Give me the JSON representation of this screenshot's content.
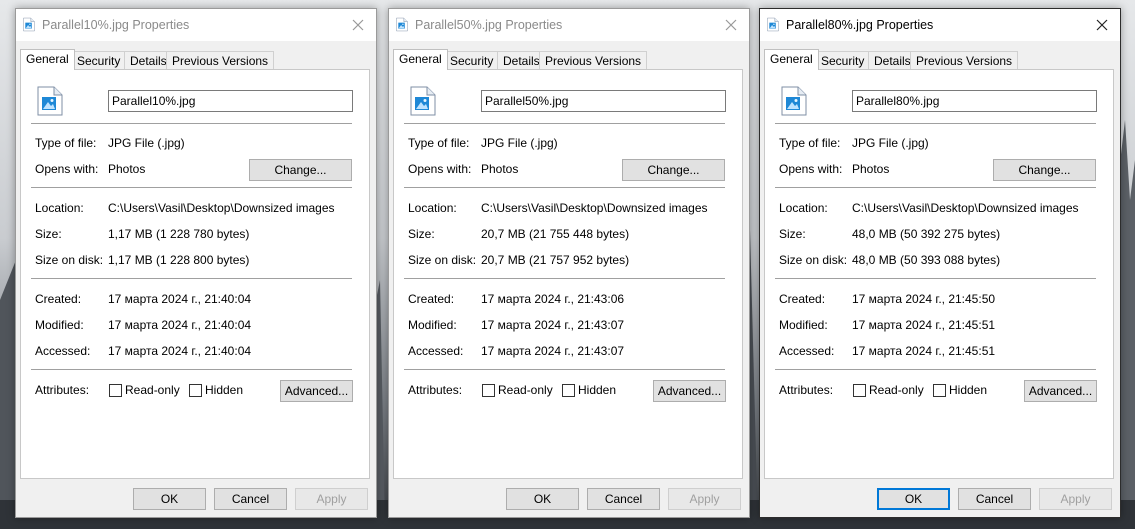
{
  "tabs": {
    "general": "General",
    "security": "Security",
    "details": "Details",
    "previous_versions": "Previous Versions"
  },
  "labels": {
    "type_of_file": "Type of file:",
    "opens_with": "Opens with:",
    "location": "Location:",
    "size": "Size:",
    "size_on_disk": "Size on disk:",
    "created": "Created:",
    "modified": "Modified:",
    "accessed": "Accessed:",
    "attributes": "Attributes:",
    "read_only": "Read-only",
    "hidden": "Hidden"
  },
  "buttons": {
    "change": "Change...",
    "advanced": "Advanced...",
    "ok": "OK",
    "cancel": "Cancel",
    "apply": "Apply"
  },
  "dialogs": [
    {
      "title": "Parallel10%.jpg Properties",
      "filename": "Parallel10%.jpg",
      "type_of_file": "JPG File (.jpg)",
      "opens_with": "Photos",
      "location": "C:\\Users\\Vasil\\Desktop\\Downsized images",
      "size": "1,17 MB (1 228 780 bytes)",
      "size_on_disk": "1,17 MB (1 228 800 bytes)",
      "created": "17 марта 2024 г., 21:40:04",
      "modified": "17 марта 2024 г., 21:40:04",
      "accessed": "17 марта 2024 г., 21:40:04",
      "read_only": false,
      "hidden": false,
      "active": false
    },
    {
      "title": "Parallel50%.jpg Properties",
      "filename": "Parallel50%.jpg",
      "type_of_file": "JPG File (.jpg)",
      "opens_with": "Photos",
      "location": "C:\\Users\\Vasil\\Desktop\\Downsized images",
      "size": "20,7 MB (21 755 448 bytes)",
      "size_on_disk": "20,7 MB (21 757 952 bytes)",
      "created": "17 марта 2024 г., 21:43:06",
      "modified": "17 марта 2024 г., 21:43:07",
      "accessed": "17 марта 2024 г., 21:43:07",
      "read_only": false,
      "hidden": false,
      "active": false
    },
    {
      "title": "Parallel80%.jpg Properties",
      "filename": "Parallel80%.jpg",
      "type_of_file": "JPG File (.jpg)",
      "opens_with": "Photos",
      "location": "C:\\Users\\Vasil\\Desktop\\Downsized images",
      "size": "48,0 MB (50 392 275 bytes)",
      "size_on_disk": "48,0 MB (50 393 088 bytes)",
      "created": "17 марта 2024 г., 21:45:50",
      "modified": "17 марта 2024 г., 21:45:51",
      "accessed": "17 марта 2024 г., 21:45:51",
      "read_only": false,
      "hidden": false,
      "active": true
    }
  ],
  "icons": {
    "title": "jpg-file-icon",
    "file": "image-file-icon",
    "close": "close-icon"
  },
  "colors": {
    "accent": "#0078d7",
    "dialog_bg": "#f0f0f0",
    "panel_bg": "#ffffff"
  }
}
